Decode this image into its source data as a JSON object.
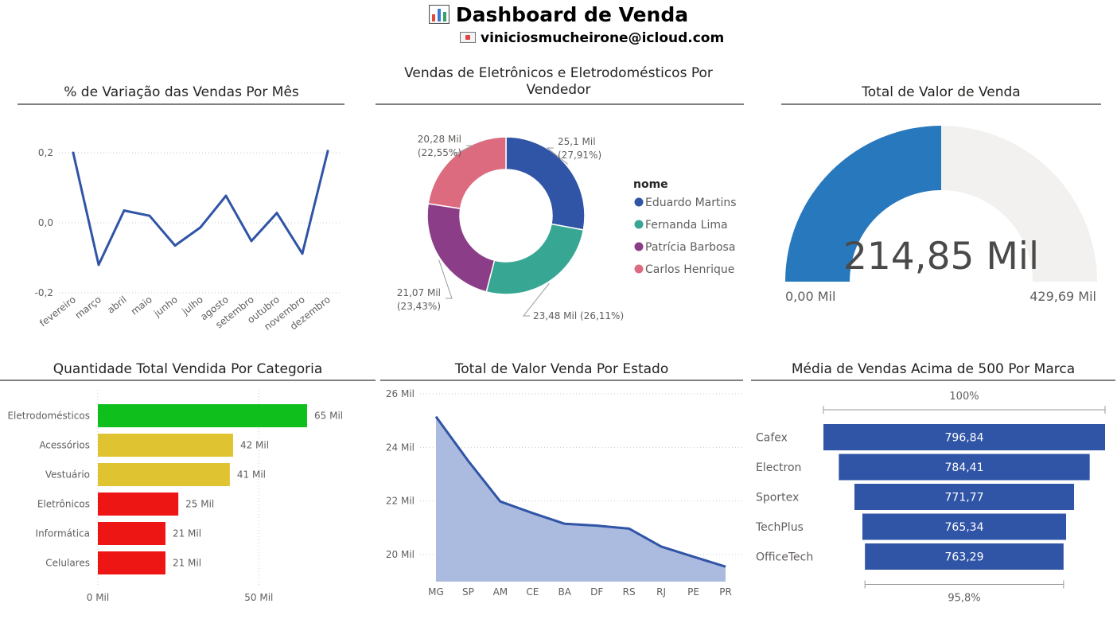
{
  "header": {
    "title": "Dashboard de Venda",
    "email": "viniciosmucheirone@icloud.com",
    "title_icon": "bar-chart-icon",
    "email_icon": "envelope-icon"
  },
  "visuals": {
    "line": {
      "title": "% de Variação das Vendas Por Mês"
    },
    "donut": {
      "title": "Vendas de Eletrônicos e Eletrodomésticos Por Vendedor"
    },
    "gauge": {
      "title": "Total de Valor de Venda"
    },
    "bar": {
      "title": "Quantidade Total Vendida Por Categoria"
    },
    "area": {
      "title": "Total de Valor Venda Por Estado"
    },
    "funnel": {
      "title": "Média de Vendas Acima de 500 Por Marca"
    }
  },
  "chart_data": [
    {
      "type": "line",
      "title": "% de Variação das Vendas Por Mês",
      "categories": [
        "fevereiro",
        "março",
        "abril",
        "maio",
        "junho",
        "julho",
        "agosto",
        "setembro",
        "outubro",
        "novembro",
        "dezembro"
      ],
      "values": [
        0.2,
        -0.12,
        0.035,
        0.02,
        -0.065,
        -0.013,
        0.077,
        -0.052,
        0.028,
        -0.088,
        0.205
      ],
      "ylim": [
        -0.2,
        0.2
      ],
      "yticks": [
        -0.2,
        0.0,
        0.2
      ],
      "ytick_labels": [
        "-0,2",
        "0,0",
        "0,2"
      ],
      "color": "#3054A6",
      "grid": true
    },
    {
      "type": "pie",
      "title": "Vendas de Eletrônicos e Eletrodomésticos Por Vendedor",
      "donut": true,
      "legend_title": "nome",
      "legend_position": "right",
      "slices": [
        {
          "name": "Eduardo Martins",
          "value": 25.1,
          "percent": 27.91,
          "label": "25,1 Mil",
          "pct_label": "(27,91%)",
          "color": "#3054A6"
        },
        {
          "name": "Fernanda Lima",
          "value": 23.48,
          "percent": 26.11,
          "label": "23,48 Mil",
          "pct_label": "(26,11%)",
          "color": "#37A794"
        },
        {
          "name": "Patrícia Barbosa",
          "value": 21.07,
          "percent": 23.43,
          "label": "21,07 Mil",
          "pct_label": "(23,43%)",
          "color": "#8B3D88"
        },
        {
          "name": "Carlos Henrique",
          "value": 20.28,
          "percent": 22.55,
          "label": "20,28 Mil",
          "pct_label": "(22,55%)",
          "color": "#DD6B7F"
        }
      ]
    },
    {
      "type": "gauge",
      "title": "Total de Valor de Venda",
      "value": 214.85,
      "value_label": "214,85 Mil",
      "min": 0,
      "min_label": "0,00 Mil",
      "max": 429.69,
      "max_label": "429,69 Mil",
      "fill_color": "#2878BD",
      "track_color": "#F2F1F0"
    },
    {
      "type": "bar",
      "orientation": "horizontal",
      "title": "Quantidade Total Vendida Por Categoria",
      "categories": [
        "Eletrodomésticos",
        "Acessórios",
        "Vestuário",
        "Eletrônicos",
        "Informática",
        "Celulares"
      ],
      "values": [
        65,
        42,
        41,
        25,
        21,
        21
      ],
      "labels": [
        "65 Mil",
        "42 Mil",
        "41 Mil",
        "25 Mil",
        "21 Mil",
        "21 Mil"
      ],
      "colors": [
        "#0FBF1B",
        "#E0C330",
        "#E0C330",
        "#EE1515",
        "#EE1515",
        "#EE1515"
      ],
      "xlim": [
        0,
        65
      ],
      "xticks": [
        0,
        50
      ],
      "xtick_labels": [
        "0 Mil",
        "50 Mil"
      ],
      "grid": true
    },
    {
      "type": "area",
      "title": "Total de Valor Venda Por Estado",
      "categories": [
        "MG",
        "SP",
        "AM",
        "CE",
        "BA",
        "DF",
        "RS",
        "RJ",
        "PE",
        "PR"
      ],
      "values": [
        25.15,
        23.5,
        21.98,
        21.55,
        21.15,
        21.08,
        20.97,
        20.3,
        19.92,
        19.55
      ],
      "ylim": [
        19.0,
        26.0
      ],
      "yticks": [
        20,
        22,
        24,
        26
      ],
      "ytick_labels": [
        "20 Mil",
        "22 Mil",
        "24 Mil",
        "26 Mil"
      ],
      "line_color": "#3054A6",
      "fill_color": "#ABBADF",
      "grid": true
    },
    {
      "type": "bar",
      "subtype": "funnel",
      "title": "Média de Vendas Acima de 500 Por Marca",
      "categories": [
        "Cafex",
        "Electron",
        "Sportex",
        "TechPlus",
        "OfficeTech"
      ],
      "values": [
        796.84,
        784.41,
        771.77,
        765.34,
        763.29
      ],
      "labels": [
        "796,84",
        "784,41",
        "771,77",
        "765,34",
        "763,29"
      ],
      "top_label": "100%",
      "bottom_label": "95,8%",
      "color": "#3054A6"
    }
  ]
}
